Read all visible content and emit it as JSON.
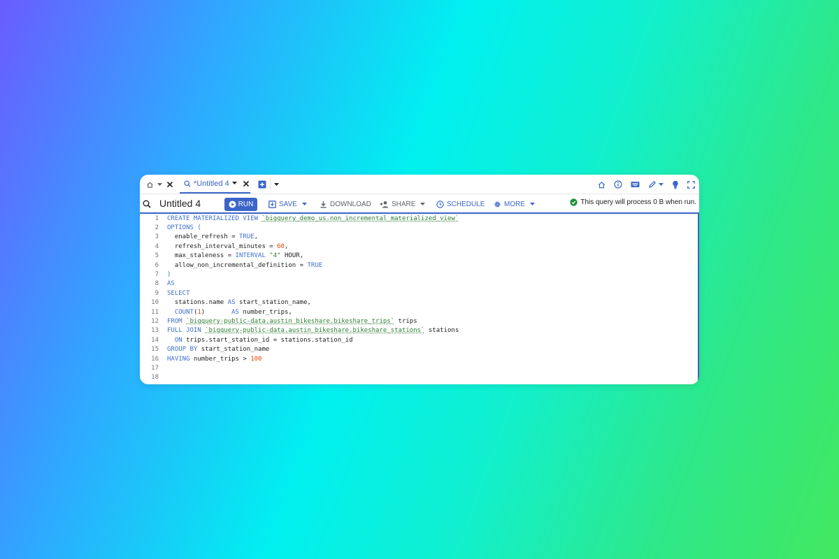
{
  "tabbar": {
    "active_tab_label": "*Untitled 4",
    "icons": [
      "home-icon",
      "chevron-down-icon",
      "close-icon",
      "query-icon",
      "add-icon",
      "home-outline-icon",
      "info-icon",
      "keyboard-icon",
      "pen-icon",
      "lightbulb-icon",
      "fullscreen-icon"
    ]
  },
  "toolbar": {
    "query_title": "Untitled 4",
    "run_label": "RUN",
    "save_label": "SAVE",
    "download_label": "DOWNLOAD",
    "share_label": "SHARE",
    "schedule_label": "SCHEDULE",
    "more_label": "MORE",
    "status_text": "This query will process 0 B when run."
  },
  "colors": {
    "accent": "#3b66c8",
    "keyword": "#3c6fd2",
    "string": "#2e7d32",
    "number": "#e0440e",
    "status_ok": "#1e8e3e"
  },
  "editor": {
    "lines": [
      {
        "n": "1",
        "tokens": [
          {
            "t": "CREATE MATERIALIZED VIEW ",
            "k": "kw"
          },
          {
            "t": "`bigquery_demo_us.non_incremental_materialized_view`",
            "k": "str"
          }
        ]
      },
      {
        "n": "2",
        "tokens": [
          {
            "t": "OPTIONS (",
            "k": "kw"
          }
        ]
      },
      {
        "n": "3",
        "tokens": [
          {
            "t": "  enable_refresh = ",
            "k": "plain"
          },
          {
            "t": "TRUE",
            "k": "kw"
          },
          {
            "t": ",",
            "k": "plain"
          }
        ]
      },
      {
        "n": "4",
        "tokens": [
          {
            "t": "  refresh_interval_minutes = ",
            "k": "plain"
          },
          {
            "t": "60",
            "k": "num"
          },
          {
            "t": ",",
            "k": "plain"
          }
        ]
      },
      {
        "n": "5",
        "tokens": [
          {
            "t": "  max_staleness = ",
            "k": "plain"
          },
          {
            "t": "INTERVAL ",
            "k": "kw"
          },
          {
            "t": "\"4\"",
            "k": "strq"
          },
          {
            "t": " HOUR,",
            "k": "plain"
          }
        ]
      },
      {
        "n": "6",
        "tokens": [
          {
            "t": "  allow_non_incremental_definition = ",
            "k": "plain"
          },
          {
            "t": "TRUE",
            "k": "kw"
          }
        ]
      },
      {
        "n": "7",
        "tokens": [
          {
            "t": ")",
            "k": "kw"
          }
        ]
      },
      {
        "n": "8",
        "tokens": [
          {
            "t": "AS",
            "k": "kw"
          }
        ]
      },
      {
        "n": "9",
        "tokens": [
          {
            "t": "SELECT",
            "k": "kw"
          }
        ]
      },
      {
        "n": "10",
        "tokens": [
          {
            "t": "  stations.name ",
            "k": "plain"
          },
          {
            "t": "AS",
            "k": "kw"
          },
          {
            "t": " start_station_name,",
            "k": "plain"
          }
        ]
      },
      {
        "n": "11",
        "tokens": [
          {
            "t": "  ",
            "k": "plain"
          },
          {
            "t": "COUNT",
            "k": "fn"
          },
          {
            "t": "(",
            "k": "plain"
          },
          {
            "t": "1",
            "k": "num"
          },
          {
            "t": ")       ",
            "k": "plain"
          },
          {
            "t": "AS",
            "k": "kw"
          },
          {
            "t": " number_trips,",
            "k": "plain"
          }
        ]
      },
      {
        "n": "12",
        "tokens": [
          {
            "t": "FROM ",
            "k": "kw"
          },
          {
            "t": "`bigquery-public-data.austin_bikeshare.bikeshare_trips`",
            "k": "str"
          },
          {
            "t": " trips",
            "k": "plain"
          }
        ]
      },
      {
        "n": "13",
        "tokens": [
          {
            "t": "FULL JOIN ",
            "k": "kw"
          },
          {
            "t": "`bigquery-public-data.austin_bikeshare.bikeshare_stations`",
            "k": "str"
          },
          {
            "t": " stations",
            "k": "plain"
          }
        ]
      },
      {
        "n": "14",
        "tokens": [
          {
            "t": "  ON",
            "k": "kw"
          },
          {
            "t": " trips.start_station_id = stations.station_id",
            "k": "plain"
          }
        ]
      },
      {
        "n": "15",
        "tokens": [
          {
            "t": "GROUP BY",
            "k": "kw"
          },
          {
            "t": " start_station_name",
            "k": "plain"
          }
        ]
      },
      {
        "n": "16",
        "tokens": [
          {
            "t": "HAVING",
            "k": "kw"
          },
          {
            "t": " number_trips > ",
            "k": "plain"
          },
          {
            "t": "100",
            "k": "num"
          }
        ]
      },
      {
        "n": "17",
        "tokens": []
      },
      {
        "n": "18",
        "tokens": []
      }
    ]
  }
}
